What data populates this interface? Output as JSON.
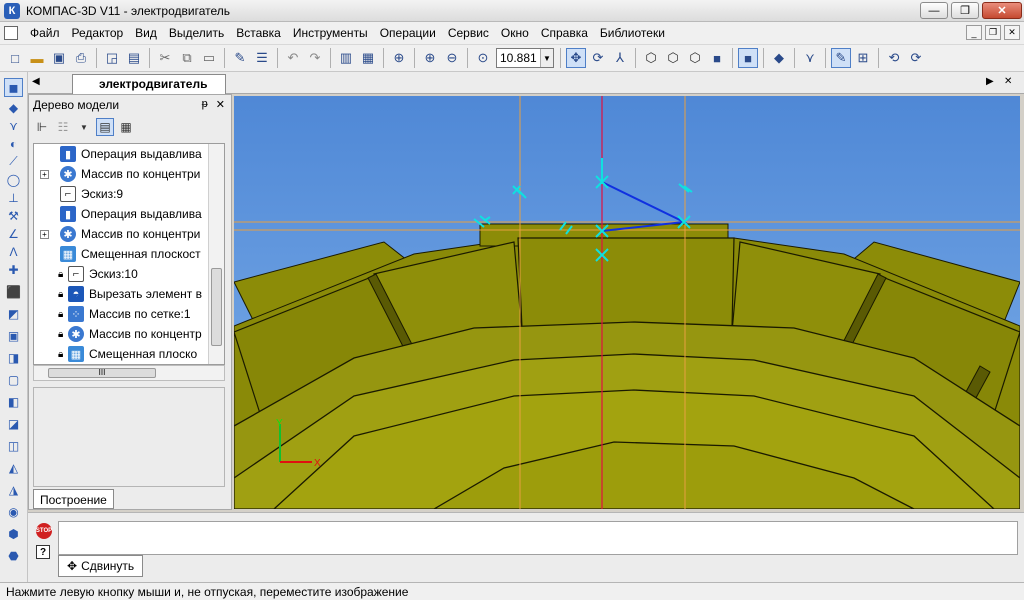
{
  "window": {
    "title": "КОМПАС-3D V11 - электродвигатель",
    "app_logo": "К",
    "buttons": {
      "minimize": "—",
      "maximize": "❐",
      "close": "✕"
    }
  },
  "menu": {
    "items": [
      "Файл",
      "Редактор",
      "Вид",
      "Выделить",
      "Вставка",
      "Инструменты",
      "Операции",
      "Сервис",
      "Окно",
      "Справка",
      "Библиотеки"
    ],
    "doc_buttons": {
      "minimize": "_",
      "restore": "❐",
      "close": "✕"
    }
  },
  "toolbar": {
    "zoom_value": "10.881",
    "zoom_arrow": "▼"
  },
  "document_tab": {
    "label": "электродвигатель",
    "left_arrow": "◀",
    "right_arrow": "▶",
    "close": "✕"
  },
  "model_tree": {
    "title": "Дерево модели",
    "pin": "ᵽ",
    "close": "✕",
    "items": [
      {
        "label": "Операция выдавлива",
        "icon": "extrude-icon",
        "expandable": false,
        "locked": false
      },
      {
        "label": "Массив по концентри",
        "icon": "circular-array-icon",
        "expandable": true,
        "locked": false
      },
      {
        "label": "Эскиз:9",
        "icon": "sketch-icon",
        "expandable": false,
        "locked": false
      },
      {
        "label": "Операция выдавлива",
        "icon": "extrude-icon",
        "expandable": false,
        "locked": false
      },
      {
        "label": "Массив по концентри",
        "icon": "circular-array-icon",
        "expandable": true,
        "locked": false
      },
      {
        "label": "Смещенная плоскост",
        "icon": "offset-plane-icon",
        "expandable": false,
        "locked": false
      },
      {
        "label": "Эскиз:10",
        "icon": "sketch-icon",
        "expandable": false,
        "locked": true
      },
      {
        "label": "Вырезать элемент в",
        "icon": "cut-extrude-icon",
        "expandable": false,
        "locked": true
      },
      {
        "label": "Массив по сетке:1",
        "icon": "grid-array-icon",
        "expandable": false,
        "locked": true
      },
      {
        "label": "Массив по концентр",
        "icon": "circular-array-icon",
        "expandable": false,
        "locked": true
      },
      {
        "label": "Смещенная плоско",
        "icon": "offset-plane-icon",
        "expandable": false,
        "locked": true
      }
    ],
    "hscroll_thumb": "III",
    "bottom_tab": "Построение"
  },
  "viewport": {
    "axes": {
      "x": "X",
      "y": "Y"
    },
    "colors": {
      "sky_top": "#4f88d6",
      "sky_bottom": "#7fb0ea",
      "model": "#8c8c08",
      "model_light": "#a3a30f",
      "sketch": "#1030e0",
      "constraint": "#10e0e0",
      "guide": "#e8a040",
      "axis_red": "#e01040"
    }
  },
  "command_panel": {
    "stop_label": "STOP",
    "help_label": "?",
    "active_command": "Сдвинуть",
    "move_icon": "✥"
  },
  "status_bar": {
    "hint": "Нажмите левую кнопку мыши и, не отпуская, переместите изображение"
  }
}
